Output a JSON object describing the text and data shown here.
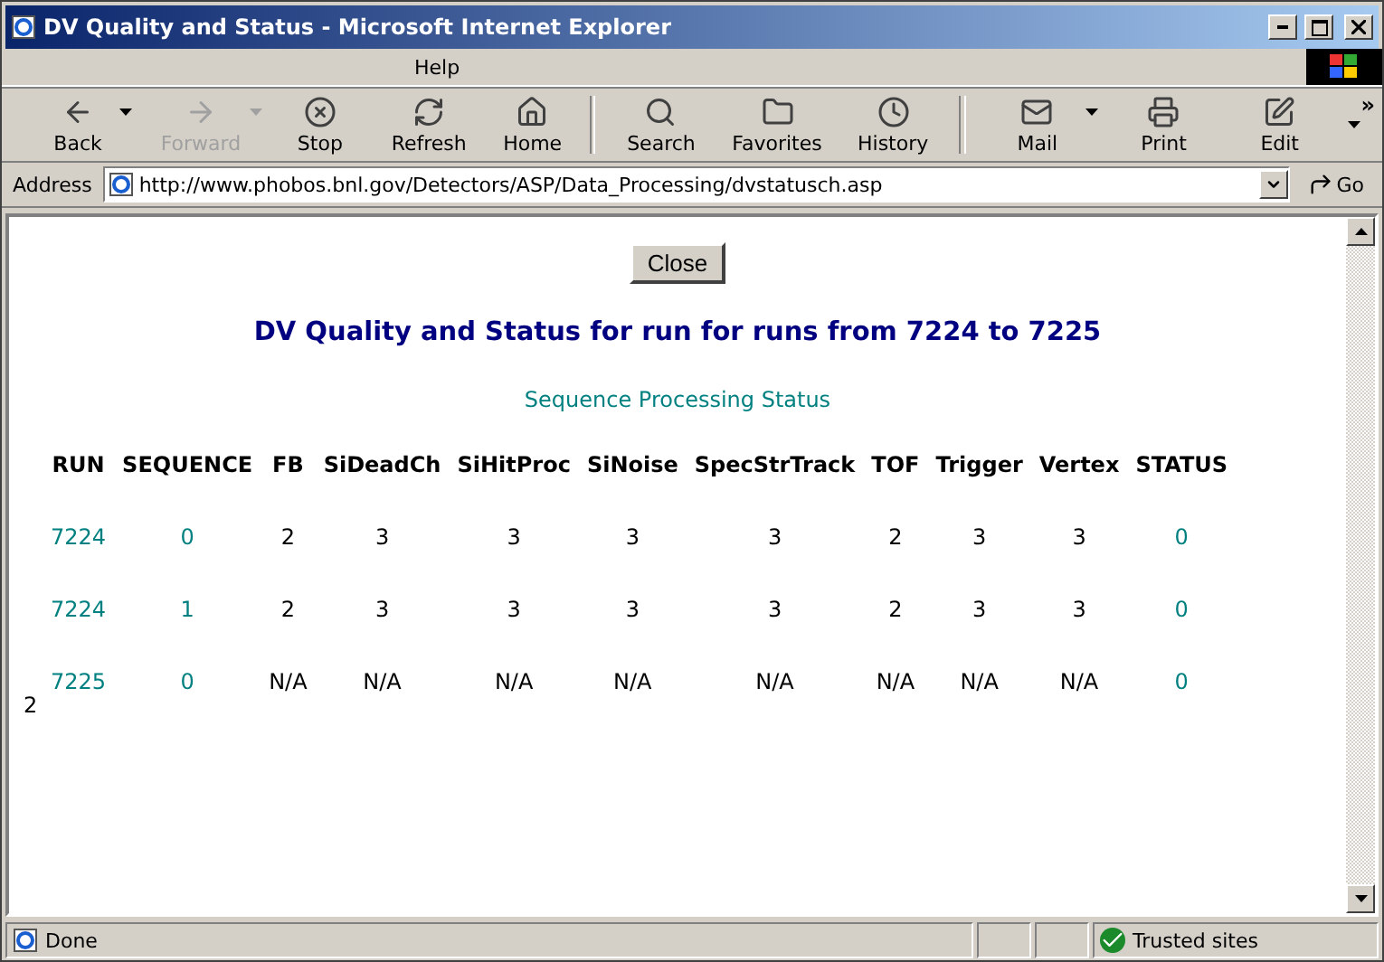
{
  "window": {
    "title": "DV Quality and Status - Microsoft Internet Explorer"
  },
  "menu": [
    "Help"
  ],
  "toolbar": [
    {
      "kind": "button",
      "label": "Back",
      "dropdown": true,
      "disabled": false
    },
    {
      "kind": "button",
      "label": "Forward",
      "dropdown": true,
      "disabled": true
    },
    {
      "kind": "button",
      "label": "Stop",
      "dropdown": false,
      "disabled": false
    },
    {
      "kind": "button",
      "label": "Refresh",
      "dropdown": false,
      "disabled": false
    },
    {
      "kind": "button",
      "label": "Home",
      "dropdown": false,
      "disabled": false
    },
    {
      "kind": "separator"
    },
    {
      "kind": "button",
      "label": "Search",
      "dropdown": false,
      "disabled": false
    },
    {
      "kind": "button",
      "label": "Favorites",
      "dropdown": false,
      "disabled": false
    },
    {
      "kind": "button",
      "label": "History",
      "dropdown": false,
      "disabled": false
    },
    {
      "kind": "separator"
    },
    {
      "kind": "button",
      "label": "Mail",
      "dropdown": true,
      "disabled": false
    },
    {
      "kind": "button",
      "label": "Print",
      "dropdown": false,
      "disabled": false
    },
    {
      "kind": "button",
      "label": "Edit",
      "dropdown": false,
      "disabled": false
    }
  ],
  "more": "»",
  "address": {
    "label": "Address",
    "value": "http://www.phobos.bnl.gov/Detectors/ASP/Data_Processing/dvstatusch.asp",
    "go": "Go"
  },
  "page": {
    "close_button": "Close",
    "heading": "DV Quality and Status for run for runs from 7224 to 7225",
    "subheading": "Sequence Processing Status",
    "table": {
      "columns": [
        {
          "label": "RUN",
          "link": true
        },
        {
          "label": "SEQUENCE",
          "link": true
        },
        {
          "label": "FB",
          "link": false
        },
        {
          "label": "SiDeadCh",
          "link": false
        },
        {
          "label": "SiHitProc",
          "link": false
        },
        {
          "label": "SiNoise",
          "link": false
        },
        {
          "label": "SpecStrTrack",
          "link": false
        },
        {
          "label": "TOF",
          "link": false
        },
        {
          "label": "Trigger",
          "link": false
        },
        {
          "label": "Vertex",
          "link": false
        },
        {
          "label": "STATUS",
          "link": true
        }
      ],
      "rows": [
        [
          "7224",
          "0",
          "2",
          "3",
          "3",
          "3",
          "3",
          "2",
          "3",
          "3",
          "0"
        ],
        [
          "7224",
          "1",
          "2",
          "3",
          "3",
          "3",
          "3",
          "2",
          "3",
          "3",
          "0"
        ],
        [
          "7225",
          "0",
          "N/A",
          "N/A",
          "N/A",
          "N/A",
          "N/A",
          "N/A",
          "N/A",
          "N/A",
          "0"
        ]
      ]
    },
    "footer_text": "2"
  },
  "status_bar": {
    "text": "Done",
    "zone": "Trusted sites"
  }
}
